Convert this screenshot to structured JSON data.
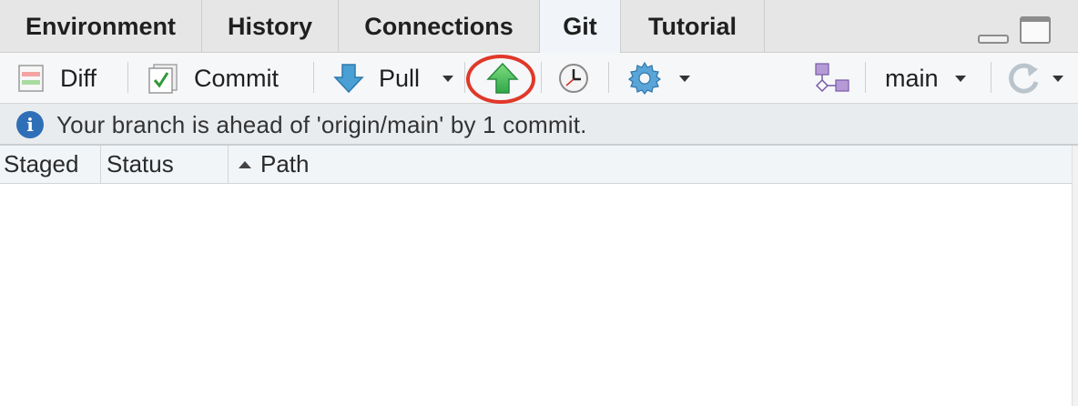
{
  "tabs": [
    {
      "label": "Environment",
      "active": false
    },
    {
      "label": "History",
      "active": false
    },
    {
      "label": "Connections",
      "active": false
    },
    {
      "label": "Git",
      "active": true
    },
    {
      "label": "Tutorial",
      "active": false
    }
  ],
  "toolbar": {
    "diff_label": "Diff",
    "commit_label": "Commit",
    "pull_label": "Pull",
    "branch_label": "main",
    "icons": {
      "diff": "diff-icon",
      "commit": "commit-icon",
      "pull": "pull-arrow-icon",
      "push": "push-arrow-icon",
      "history": "clock-icon",
      "more": "gear-icon",
      "branches": "branch-icon",
      "refresh": "refresh-icon"
    }
  },
  "info": {
    "message": "Your branch is ahead of 'origin/main' by 1 commit."
  },
  "table": {
    "columns": [
      "Staged",
      "Status",
      "Path"
    ],
    "sorted_column": "Path",
    "rows": []
  },
  "colors": {
    "highlight_ring": "#e0382a",
    "push_arrow": "#3cb54a",
    "pull_arrow": "#3a8fc6",
    "info_icon": "#2f6fb7"
  }
}
